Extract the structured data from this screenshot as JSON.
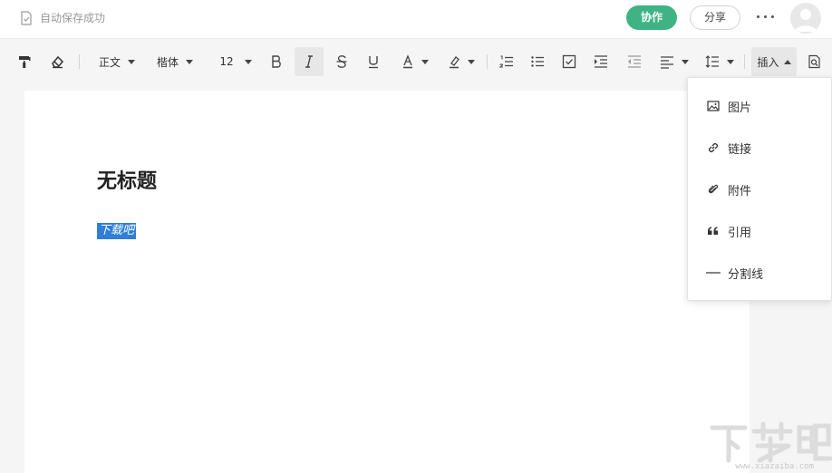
{
  "header": {
    "save_status": "自动保存成功",
    "collab_label": "协作",
    "share_label": "分享"
  },
  "toolbar": {
    "paragraph_style": "正文",
    "font_family": "楷体",
    "font_size": "12",
    "insert_label": "插入"
  },
  "document": {
    "title": "无标题",
    "selected_text": "下载吧"
  },
  "insert_menu": {
    "items": [
      {
        "label": "图片",
        "icon": "image-icon"
      },
      {
        "label": "链接",
        "icon": "link-icon"
      },
      {
        "label": "附件",
        "icon": "attachment-icon"
      },
      {
        "label": "引用",
        "icon": "quote-icon"
      },
      {
        "label": "分割线",
        "icon": "divider-icon"
      }
    ]
  },
  "watermark": {
    "text": "下载吧",
    "url": "www.xiazaiba.com"
  },
  "colors": {
    "accent": "#3fb383",
    "selection": "#2f7fd8"
  }
}
